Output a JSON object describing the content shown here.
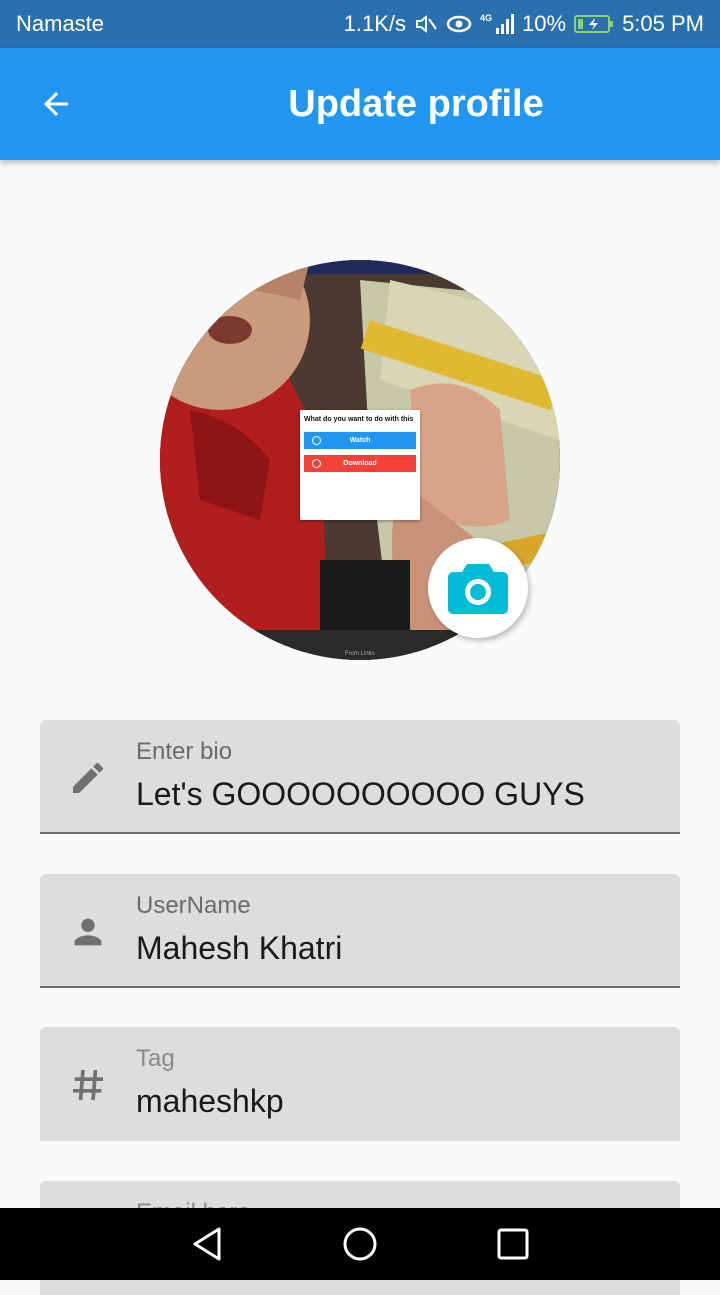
{
  "status_bar": {
    "carrier": "Namaste",
    "speed": "1.1K/s",
    "network": "4G",
    "battery": "10%",
    "time": "5:05 PM"
  },
  "app_bar": {
    "title": "Update profile",
    "back_icon": "arrow-back-icon",
    "color": "#2196f3"
  },
  "avatar": {
    "dialog": {
      "title": "What do you want to do with this",
      "watch_label": "Watch",
      "download_label": "Download"
    },
    "bottom_strip_label": "From Links",
    "camera_icon": "camera-icon",
    "camera_color": "#00bcd4"
  },
  "fields": {
    "bio": {
      "label": "Enter bio",
      "value": "Let's GOOOOOOOOOO GUYS",
      "icon": "edit-pencil-icon"
    },
    "username": {
      "label": "UserName",
      "value": "Mahesh Khatri",
      "icon": "person-icon"
    },
    "tag": {
      "label": "Tag",
      "value": "maheshkp",
      "icon": "hashtag-icon"
    },
    "email": {
      "label": "Email here",
      "value": "",
      "icon": "email-icon"
    }
  },
  "nav_bar": {
    "back_icon": "nav-back-icon",
    "home_icon": "nav-home-icon",
    "recents_icon": "nav-recents-icon"
  }
}
